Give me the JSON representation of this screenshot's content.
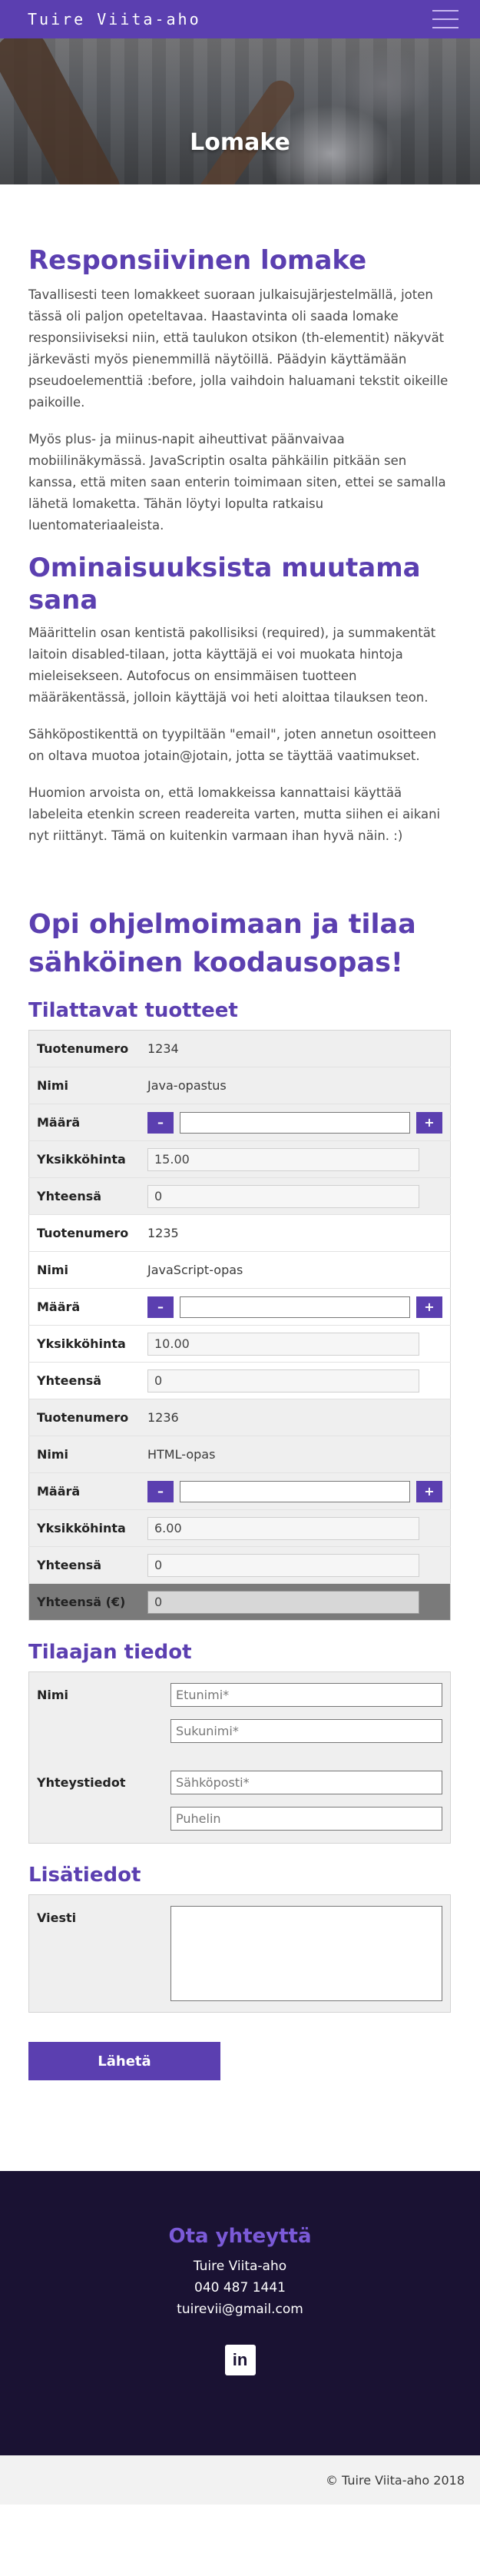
{
  "header": {
    "brand": "Tuire Viita-aho",
    "menu_icon": "hamburger-menu-icon"
  },
  "hero": {
    "title": "Lomake"
  },
  "intro": {
    "heading": "Responsiivinen lomake",
    "p1": "Tavallisesti teen lomakkeet suoraan julkaisujärjestelmällä, joten tässä oli paljon opeteltavaa. Haastavinta oli saada lomake responsiiviseksi niin, että taulukon otsikon (th-elementit) näkyvät järkevästi myös pienemmillä näytöillä. Päädyin käyttämään pseudoelementtiä :before, jolla vaihdoin haluamani tekstit oikeille paikoille.",
    "p2": "Myös plus- ja miinus-napit aiheuttivat päänvaivaa mobiilinäkymässä. JavaScriptin osalta pähkäilin pitkään sen kanssa, että miten saan enterin toimimaan siten, ettei se samalla lähetä lomaketta. Tähän löytyi lopulta ratkaisu luentomateriaaleista."
  },
  "features": {
    "heading": "Ominaisuuksista muutama sana",
    "p1": "Määrittelin osan kentistä pakollisiksi (required), ja summakentät laitoin disabled-tilaan, jotta käyttäjä ei voi muokata hintoja mieleisekseen. Autofocus on ensimmäisen tuotteen määräkentässä, jolloin käyttäjä voi heti aloittaa tilauksen teon.",
    "p2": "Sähköpostikenttä on tyypiltään \"email\", joten annetun osoitteen on oltava muotoa jotain@jotain, jotta se täyttää vaatimukset.",
    "p3": "Huomion arvoista on, että lomakkeissa kannattaisi käyttää labeleita etenkin screen readereita varten, mutta siihen ei aikani nyt riittänyt. Tämä on kuitenkin varmaan ihan hyvä näin. :)"
  },
  "form": {
    "heading": "Opi ohjelmoimaan ja tilaa sähköinen koodausopas!",
    "products_heading": "Tilattavat tuotteet",
    "labels": {
      "id": "Tuotenumero",
      "name": "Nimi",
      "qty": "Määrä",
      "unit": "Yksikköhinta",
      "sum": "Yhteensä"
    },
    "minus": "–",
    "plus": "+",
    "products": [
      {
        "id": "1234",
        "name": "Java-opastus",
        "unit": "15.00",
        "sum": "0"
      },
      {
        "id": "1235",
        "name": "JavaScript-opas",
        "unit": "10.00",
        "sum": "0"
      },
      {
        "id": "1236",
        "name": "HTML-opas",
        "unit": "6.00",
        "sum": "0"
      }
    ],
    "grand_total_label": "Yhteensä (€)",
    "grand_total_value": "0",
    "customer_heading": "Tilaajan tiedot",
    "name_label": "Nimi",
    "firstname_placeholder": "Etunimi*",
    "lastname_placeholder": "Sukunimi*",
    "contact_label": "Yhteystiedot",
    "email_placeholder": "Sähköposti*",
    "phone_placeholder": "Puhelin",
    "extra_heading": "Lisätiedot",
    "message_label": "Viesti",
    "submit": "Lähetä"
  },
  "footer": {
    "heading": "Ota yhteyttä",
    "name": "Tuire Viita-aho",
    "phone": "040 487 1441",
    "email": "tuirevii@gmail.com",
    "linkedin_glyph": "in",
    "copyright": "© Tuire Viita-aho 2018"
  }
}
